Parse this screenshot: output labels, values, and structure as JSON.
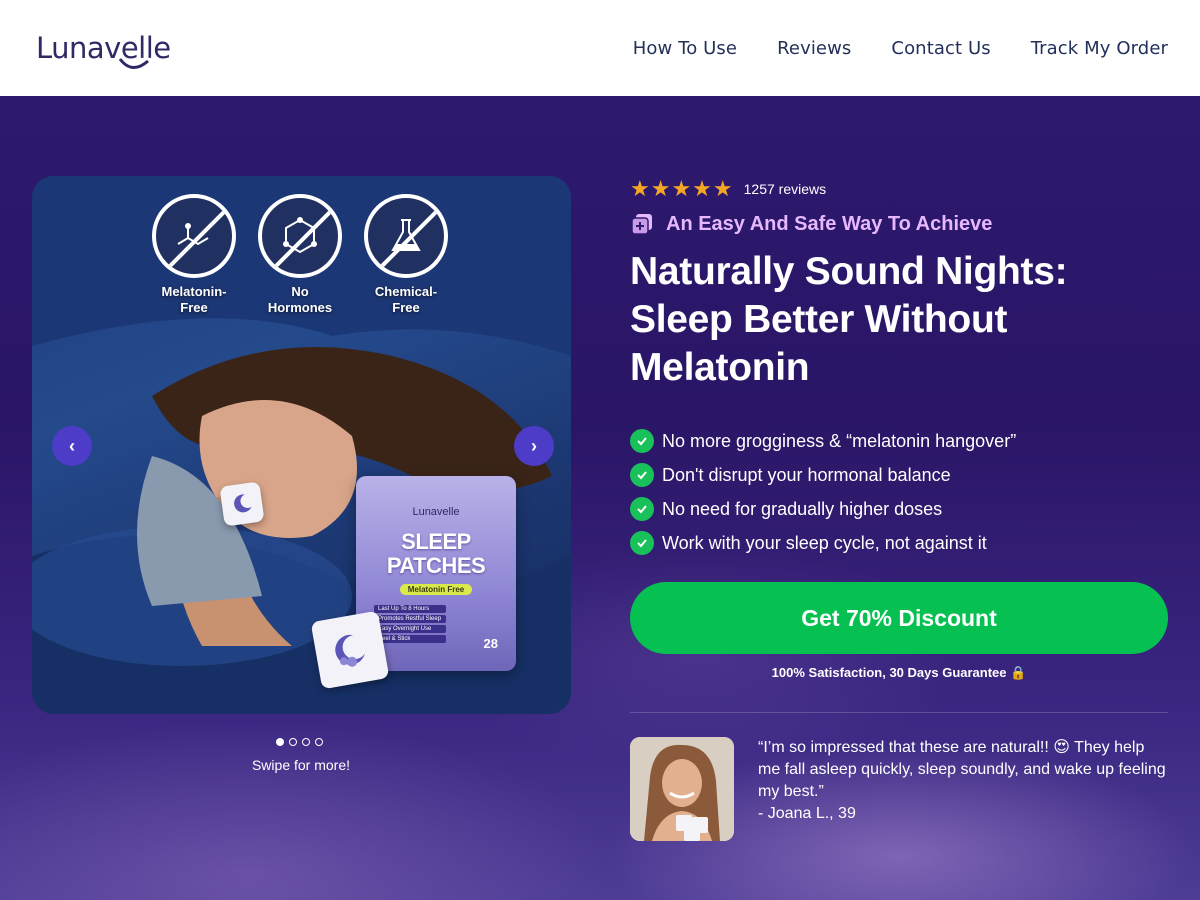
{
  "header": {
    "logo": "Lunavelle",
    "nav": [
      "How To Use",
      "Reviews",
      "Contact Us",
      "Track My Order"
    ]
  },
  "gallery": {
    "badges": [
      "Melatonin-\nFree",
      "No\nHormones",
      "Chemical-\nFree"
    ],
    "product": {
      "brand": "Lunavelle",
      "title": "SLEEP PATCHES",
      "tag": "Melatonin Free",
      "features": [
        "Last Up To 8 Hours",
        "Promotes Restful Sleep",
        "Easy Overnight Use",
        "Peel & Stick"
      ],
      "count": "28"
    },
    "prev_icon": "chevron-left-icon",
    "next_icon": "chevron-right-icon",
    "dots_total": 4,
    "active_dot": 1,
    "swipe_text": "Swipe for more!"
  },
  "rating": {
    "stars": "★★★★★",
    "count_text": "1257 reviews"
  },
  "eyebrow": "An Easy And Safe Way To Achieve",
  "headline": "Naturally Sound Nights: Sleep Better Without Melatonin",
  "benefits": [
    "No more grogginess & “melatonin hangover”",
    "Don't disrupt your hormonal balance",
    "No need for gradually higher doses",
    "Work with your sleep cycle, not against it"
  ],
  "cta": {
    "label": "Get 70% Discount"
  },
  "guarantee": "100% Satisfaction, 30 Days Guarantee 🔒",
  "testimonial": {
    "quote": "“I’m so impressed that these are natural!! 😍 They help me fall asleep quickly, sleep soundly, and wake up feeling my best.”",
    "author": "- Joana L., 39"
  },
  "colors": {
    "cta": "#06c152",
    "check": "#19c15a",
    "star": "#f5a623",
    "eyebrow": "#e7b8ff",
    "nav_arrow": "#4c3cc7",
    "brand": "#2e2a66"
  }
}
